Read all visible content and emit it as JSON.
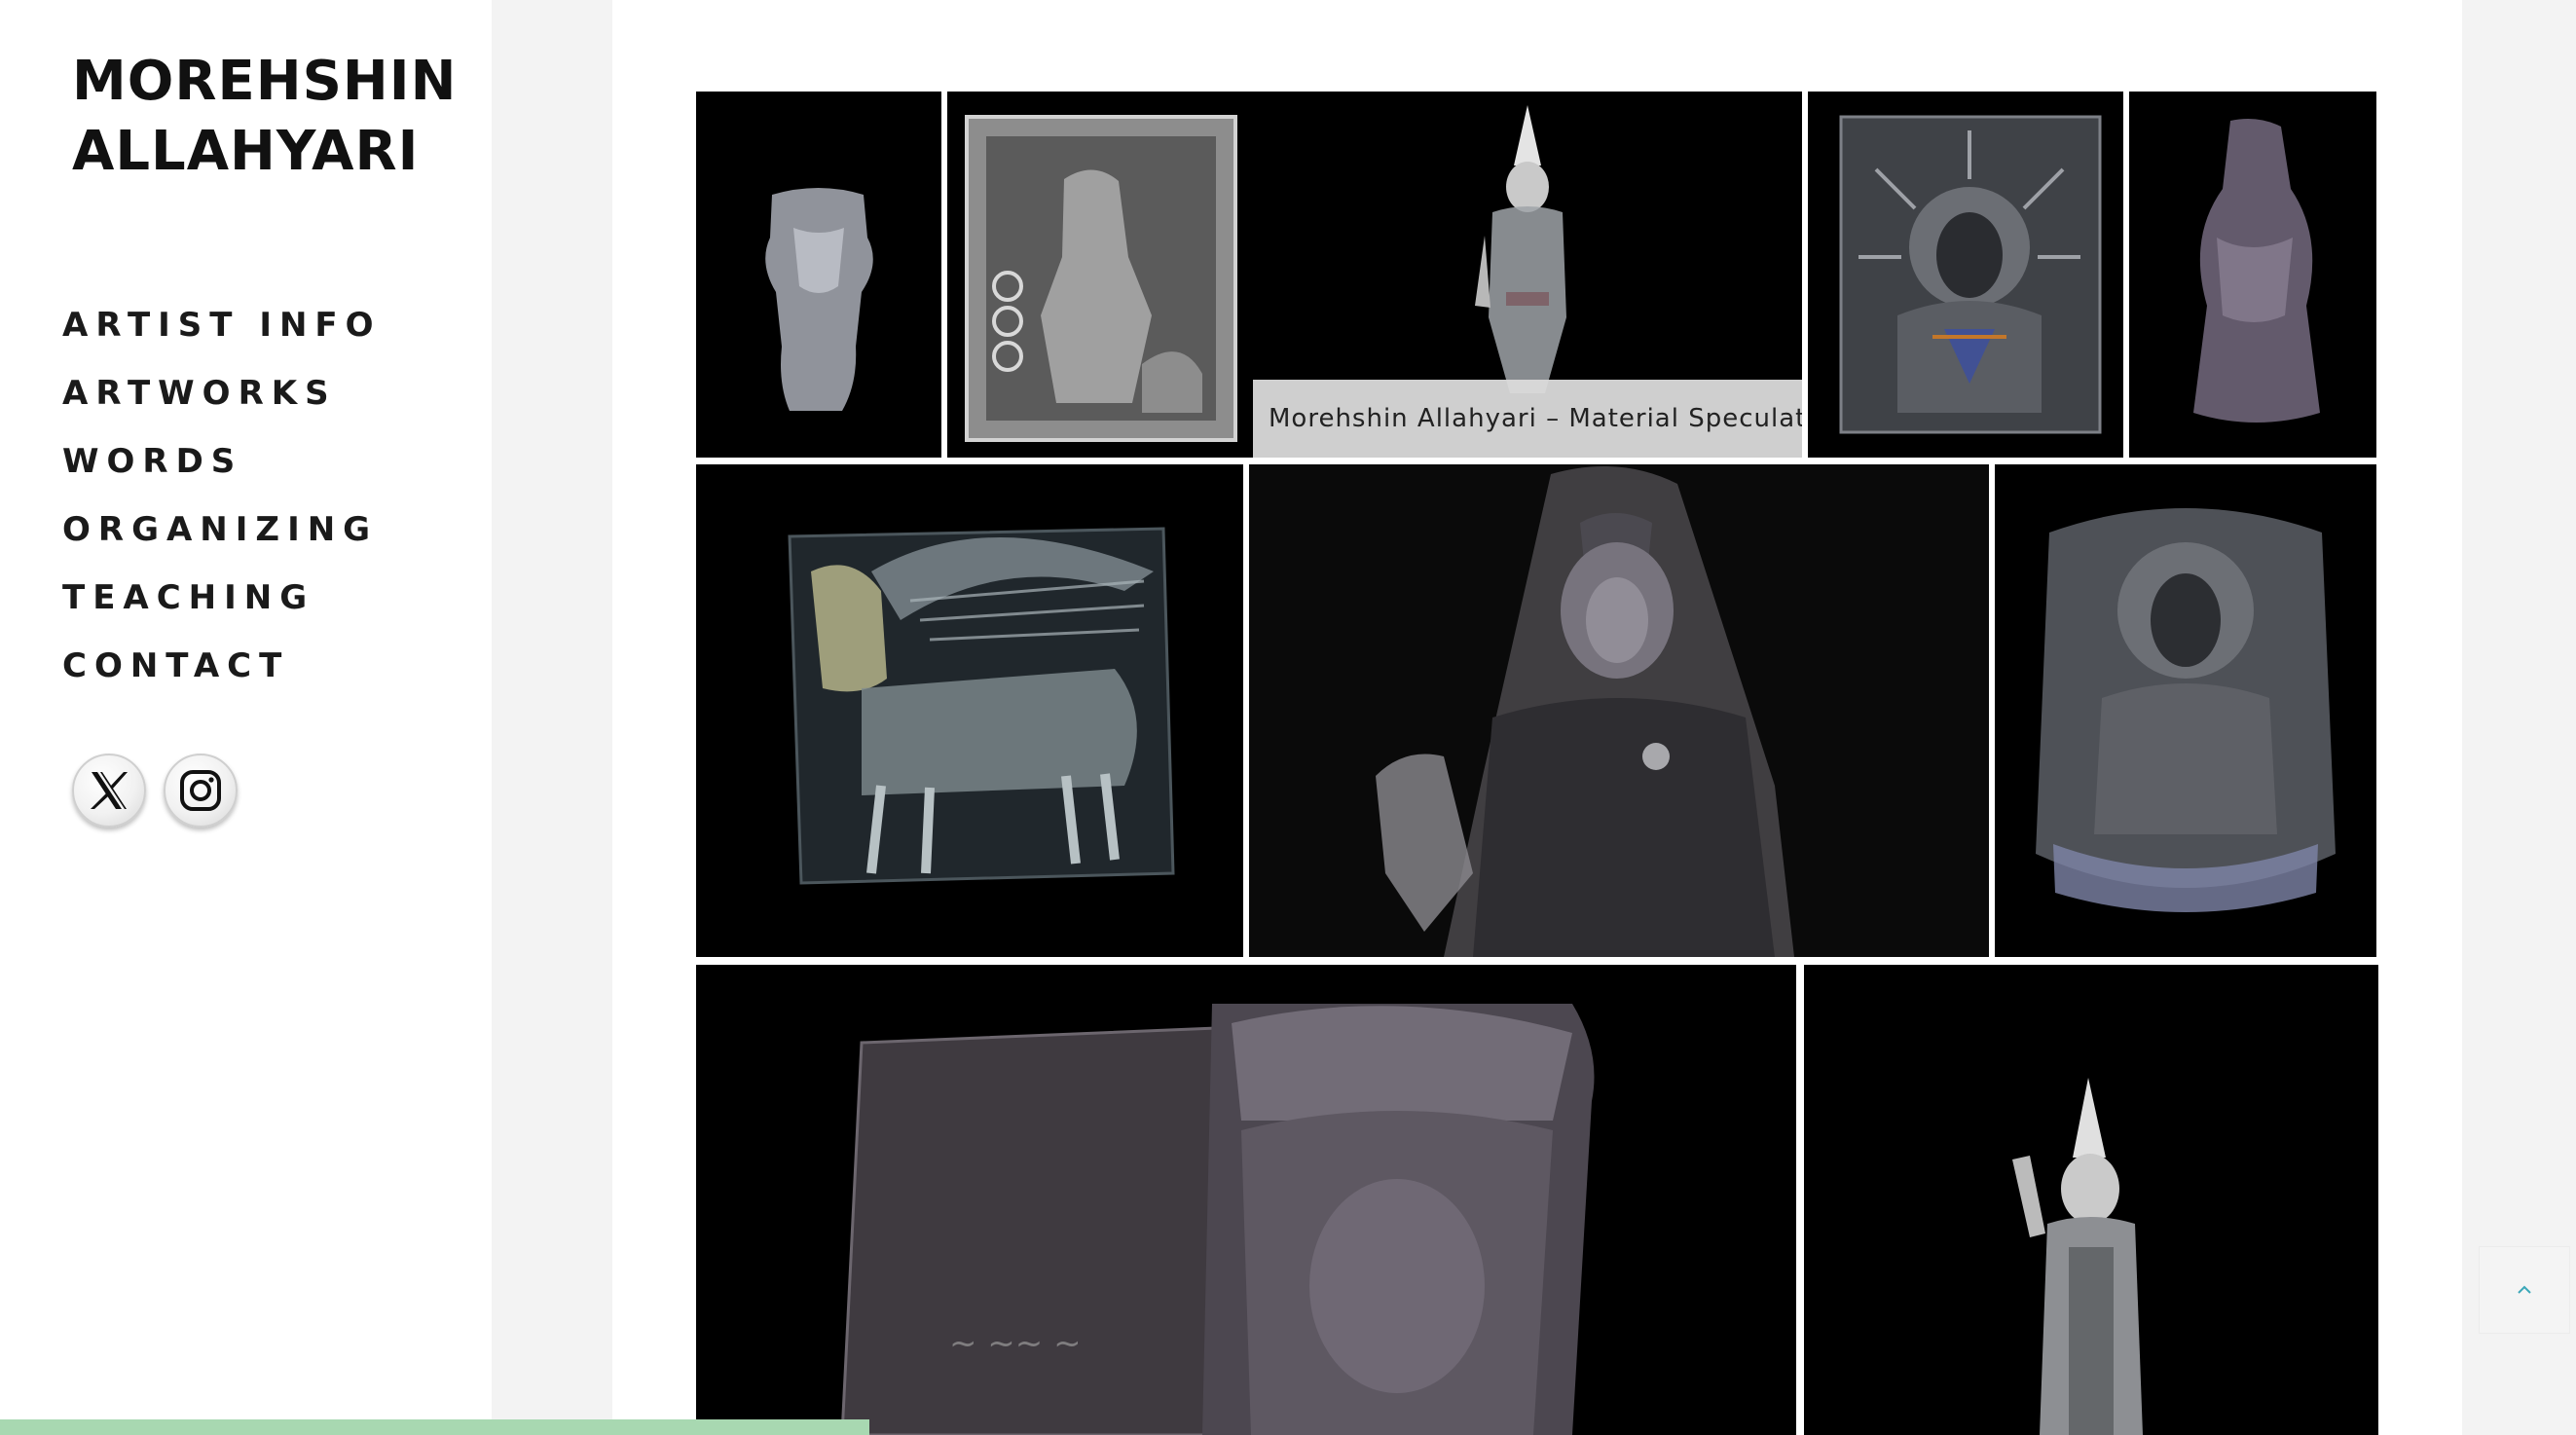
{
  "site": {
    "title_line1": "MOREHSHIN",
    "title_line2": "ALLAHYARI"
  },
  "nav": {
    "items": [
      {
        "label": "ARTIST INFO"
      },
      {
        "label": "ARTWORKS"
      },
      {
        "label": "WORDS"
      },
      {
        "label": "ORGANIZING"
      },
      {
        "label": "TEACHING"
      },
      {
        "label": "CONTACT"
      }
    ]
  },
  "social": [
    {
      "icon": "x-twitter-icon"
    },
    {
      "icon": "instagram-icon"
    }
  ],
  "gallery": {
    "hover_caption": "Morehshin Allahyari – Material Speculation –..."
  },
  "scroll_top": {
    "icon": "chevron-up-icon",
    "color": "#3aa7b8"
  },
  "colors": {
    "background": "#f3f3f3",
    "panel": "#ffffff",
    "tile": "#000000",
    "cookie_bar": "#a8d8b1"
  }
}
